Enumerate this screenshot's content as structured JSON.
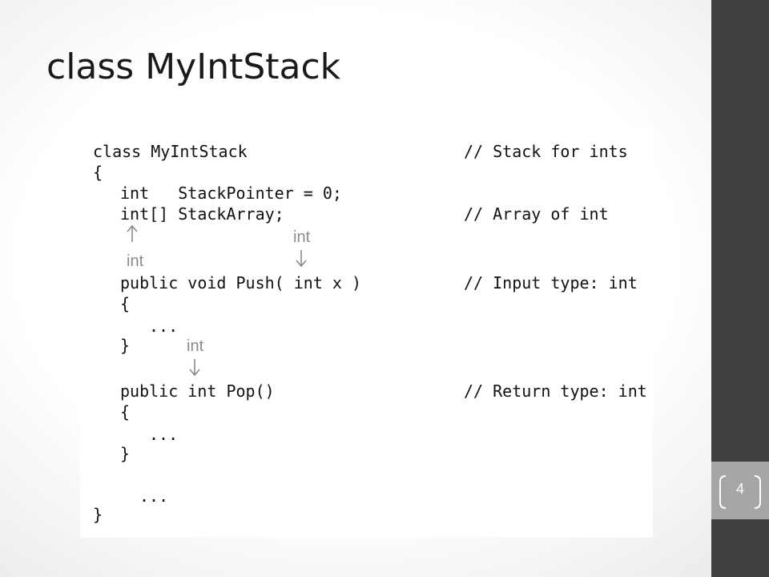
{
  "slide": {
    "title": "class MyIntStack",
    "page_number": "4"
  },
  "code": {
    "lines": [
      "class MyIntStack",
      "{",
      "int   StackPointer = 0;",
      "int[] StackArray;",
      "public void Push( int x )",
      "{",
      "...",
      "}",
      "public int Pop()",
      "{",
      "...",
      "}",
      "...",
      "}"
    ],
    "comments": [
      "// Stack for ints",
      "// Array of int",
      "// Input type: int",
      "// Return type: int"
    ],
    "annotations": [
      "int",
      "int",
      "int"
    ]
  },
  "colors": {
    "sidebar": "#404040",
    "page_tab": "#a6a6a6",
    "annotation_text": "#8a8a8a"
  }
}
